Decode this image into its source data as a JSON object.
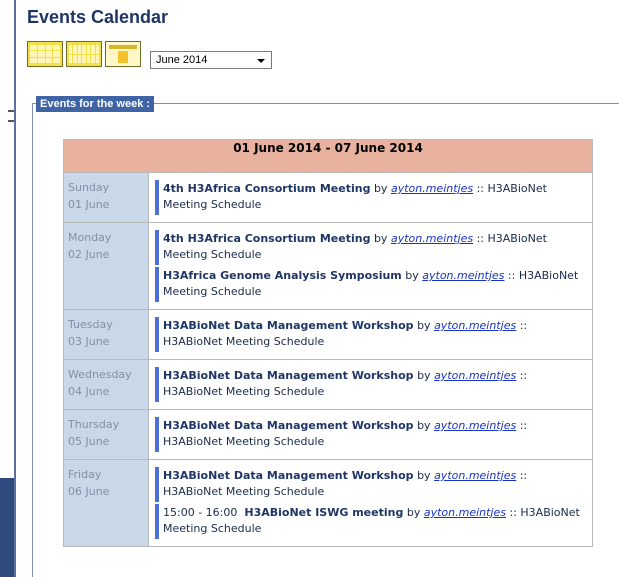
{
  "page": {
    "title": "Events Calendar"
  },
  "toolbar": {
    "views": [
      {
        "name": "month-view-icon"
      },
      {
        "name": "week-view-icon"
      },
      {
        "name": "day-view-icon"
      }
    ],
    "month_select": {
      "value": "June 2014"
    }
  },
  "events_section": {
    "legend": "Events for the week :"
  },
  "week": {
    "range": "01 June 2014 - 07 June 2014",
    "days": [
      {
        "weekday": "Sunday",
        "date": "01 June",
        "events": [
          {
            "time": "",
            "title": "4th H3Africa Consortium Meeting",
            "by": "by",
            "author": "ayton.meintjes",
            "sep": "::",
            "calendar": "H3ABioNet Meeting Schedule"
          }
        ]
      },
      {
        "weekday": "Monday",
        "date": "02 June",
        "events": [
          {
            "time": "",
            "title": "4th H3Africa Consortium Meeting",
            "by": "by",
            "author": "ayton.meintjes",
            "sep": "::",
            "calendar": "H3ABioNet Meeting Schedule"
          },
          {
            "time": "",
            "title": "H3Africa Genome Analysis Symposium",
            "by": "by",
            "author": "ayton.meintjes",
            "sep": "::",
            "calendar": "H3ABioNet Meeting Schedule"
          }
        ]
      },
      {
        "weekday": "Tuesday",
        "date": "03 June",
        "events": [
          {
            "time": "",
            "title": "H3ABioNet Data Management Workshop",
            "by": "by",
            "author": "ayton.meintjes",
            "sep": "::",
            "calendar": "H3ABioNet Meeting Schedule"
          }
        ]
      },
      {
        "weekday": "Wednesday",
        "date": "04 June",
        "events": [
          {
            "time": "",
            "title": "H3ABioNet Data Management Workshop",
            "by": "by",
            "author": "ayton.meintjes",
            "sep": "::",
            "calendar": "H3ABioNet Meeting Schedule"
          }
        ]
      },
      {
        "weekday": "Thursday",
        "date": "05 June",
        "events": [
          {
            "time": "",
            "title": "H3ABioNet Data Management Workshop",
            "by": "by",
            "author": "ayton.meintjes",
            "sep": "::",
            "calendar": "H3ABioNet Meeting Schedule"
          }
        ]
      },
      {
        "weekday": "Friday",
        "date": "06 June",
        "events": [
          {
            "time": "",
            "title": "H3ABioNet Data Management Workshop",
            "by": "by",
            "author": "ayton.meintjes",
            "sep": "::",
            "calendar": "H3ABioNet Meeting Schedule"
          },
          {
            "time": "15:00 - 16:00",
            "title": "H3ABioNet ISWG meeting",
            "by": "by",
            "author": "ayton.meintjes",
            "sep": "::",
            "calendar": "H3ABioNet Meeting Schedule"
          }
        ]
      }
    ]
  },
  "colors": {
    "accent": "#3e64a6",
    "header_bg": "#e9b29e",
    "day_bg": "#c8d8e8",
    "event_bar": "#4d6fd8",
    "link": "#1a33c7"
  }
}
